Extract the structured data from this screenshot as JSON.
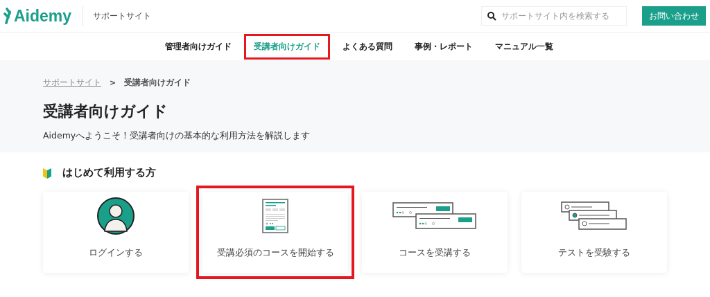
{
  "header": {
    "logo": "Aidemy",
    "site_name": "サポートサイト",
    "search": {
      "placeholder": "サポートサイト内を検索する"
    },
    "contact_button": "お問い合わせ"
  },
  "nav": [
    {
      "label": "管理者向けガイド",
      "selected": false,
      "highlighted": false
    },
    {
      "label": "受講者向けガイド",
      "selected": true,
      "highlighted": true
    },
    {
      "label": "よくある質問",
      "selected": false,
      "highlighted": false
    },
    {
      "label": "事例・レポート",
      "selected": false,
      "highlighted": false
    },
    {
      "label": "マニュアル一覧",
      "selected": false,
      "highlighted": false
    }
  ],
  "breadcrumb_separator": ">",
  "breadcrumb": [
    {
      "label": "サポートサイト",
      "kind": "link"
    },
    {
      "label": "受講者向けガイド",
      "kind": "current"
    }
  ],
  "page": {
    "title": "受講者向けガイド",
    "subtitle": "Aidemyへようこそ！受講者向けの基本的な利用方法を解説します"
  },
  "section": {
    "heading": "はじめて利用する方",
    "cards": [
      {
        "label": "ログインする",
        "kind": "person",
        "highlighted": false
      },
      {
        "label": "受講必須のコースを開始する",
        "kind": "document",
        "highlighted": true
      },
      {
        "label": "コースを受講する",
        "kind": "courses",
        "highlighted": false
      },
      {
        "label": "テストを受験する",
        "kind": "test",
        "highlighted": false
      }
    ]
  }
}
